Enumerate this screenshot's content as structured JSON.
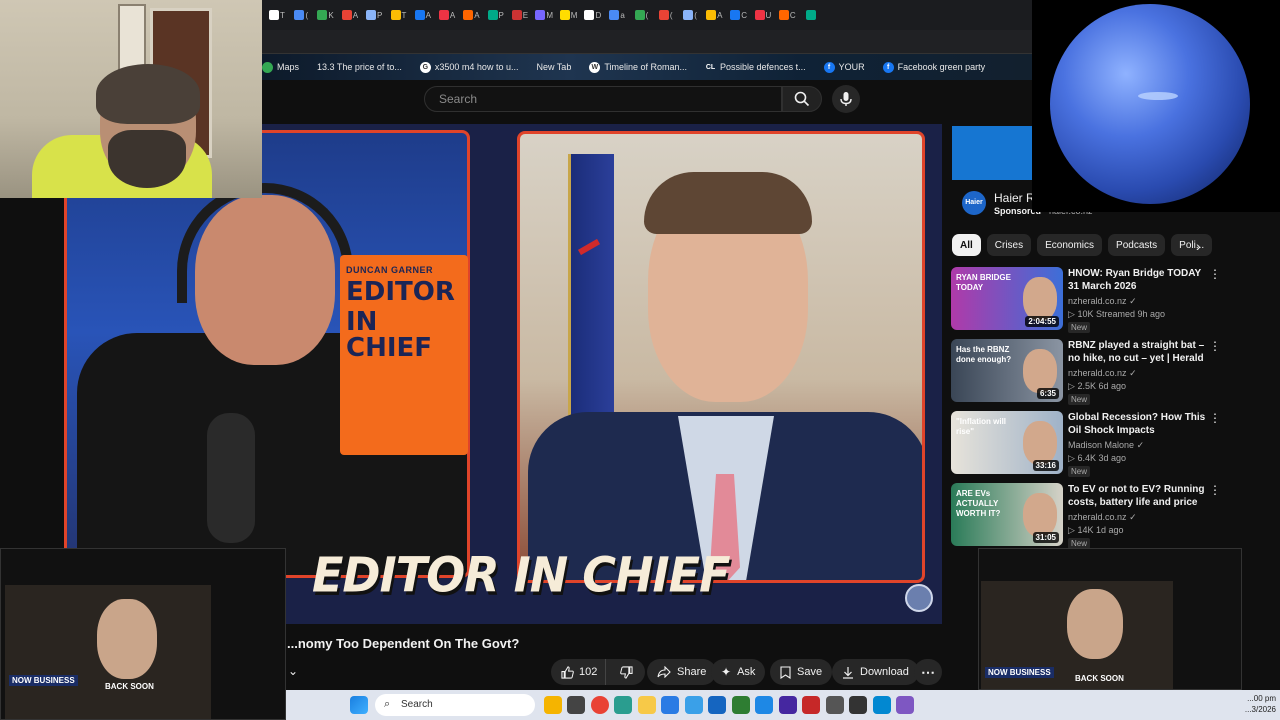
{
  "browser": {
    "tab_labels": [
      "T",
      "(",
      "K",
      "A",
      "P",
      "T",
      "A",
      "A",
      "A",
      "P",
      "E",
      "M",
      "M",
      "D",
      "a",
      "(",
      "(",
      "(",
      "A",
      "C",
      "U",
      "C",
      ""
    ],
    "bookmarks": [
      {
        "label": "Maps",
        "color": "#34a853",
        "glyph": ""
      },
      {
        "label": "13.3 The price of to...",
        "color": "",
        "glyph": ""
      },
      {
        "label": "x3500 m4 how to u...",
        "color": "#ffffff",
        "glyph": "G"
      },
      {
        "label": "New Tab",
        "color": "",
        "glyph": ""
      },
      {
        "label": "Timeline of Roman...",
        "color": "#ffffff",
        "glyph": "W"
      },
      {
        "label": "Possible defences t...",
        "color": "",
        "glyph": "CL"
      },
      {
        "label": "YOUR",
        "color": "#1877f2",
        "glyph": "f"
      },
      {
        "label": "Facebook green party",
        "color": "#1877f2",
        "glyph": "f"
      }
    ]
  },
  "youtube": {
    "search_placeholder": "Search",
    "video": {
      "caption": "EDITOR IN CHIEF",
      "promo_small": "DUNCAN GARNER",
      "promo_big_1": "EDITOR",
      "promo_big_2": "IN CHIEF",
      "title": "...nomy Too Dependent On The Govt?"
    },
    "actions": {
      "like_count": "102",
      "share": "Share",
      "ask": "Ask",
      "save": "Save",
      "download": "Download"
    },
    "ad": {
      "title": "Haier Re...",
      "sponsored": "Sponsored",
      "domain": "haier.co.nz",
      "logo": "Haier"
    },
    "chips": [
      "All",
      "Crises",
      "Economics",
      "Podcasts",
      "Poli..."
    ],
    "recommendations": [
      {
        "title": "HNOW: Ryan Bridge TODAY 31 March 2026",
        "channel": "nzherald.co.nz",
        "meta": "10K  Streamed 9h ago",
        "badge": "New",
        "duration": "2:04:55",
        "thumb_text": "RYAN BRIDGE TODAY"
      },
      {
        "title": "RBNZ played a straight bat – no hike, no cut – yet | Herald NO...",
        "channel": "nzherald.co.nz",
        "meta": "2.5K  6d ago",
        "badge": "New",
        "duration": "6:35",
        "thumb_text": "Has the RBNZ done enough?"
      },
      {
        "title": "Global Recession? How This Oil Shock Impacts Everything",
        "channel": "Madison Malone",
        "meta": "6.4K  3d ago",
        "badge": "New",
        "duration": "33:16",
        "thumb_text": "\"Inflation will rise\""
      },
      {
        "title": "To EV or not to EV? Running costs, battery life and price ...",
        "channel": "nzherald.co.nz",
        "meta": "14K  1d ago",
        "badge": "New",
        "duration": "31:05",
        "thumb_text": "ARE EVs ACTUALLY WORTH IT?"
      }
    ]
  },
  "overlays": {
    "mini_now": "NOW BUSINESS",
    "mini_back_soon": "BACK SOON"
  },
  "taskbar": {
    "search_label": "Search",
    "clock_time": "...00 pm",
    "clock_date": "...3/2026"
  },
  "colors": {
    "accent_red": "#e0442a",
    "promo_orange": "#f36b1c",
    "youtube_bg": "#0f0f0f"
  }
}
